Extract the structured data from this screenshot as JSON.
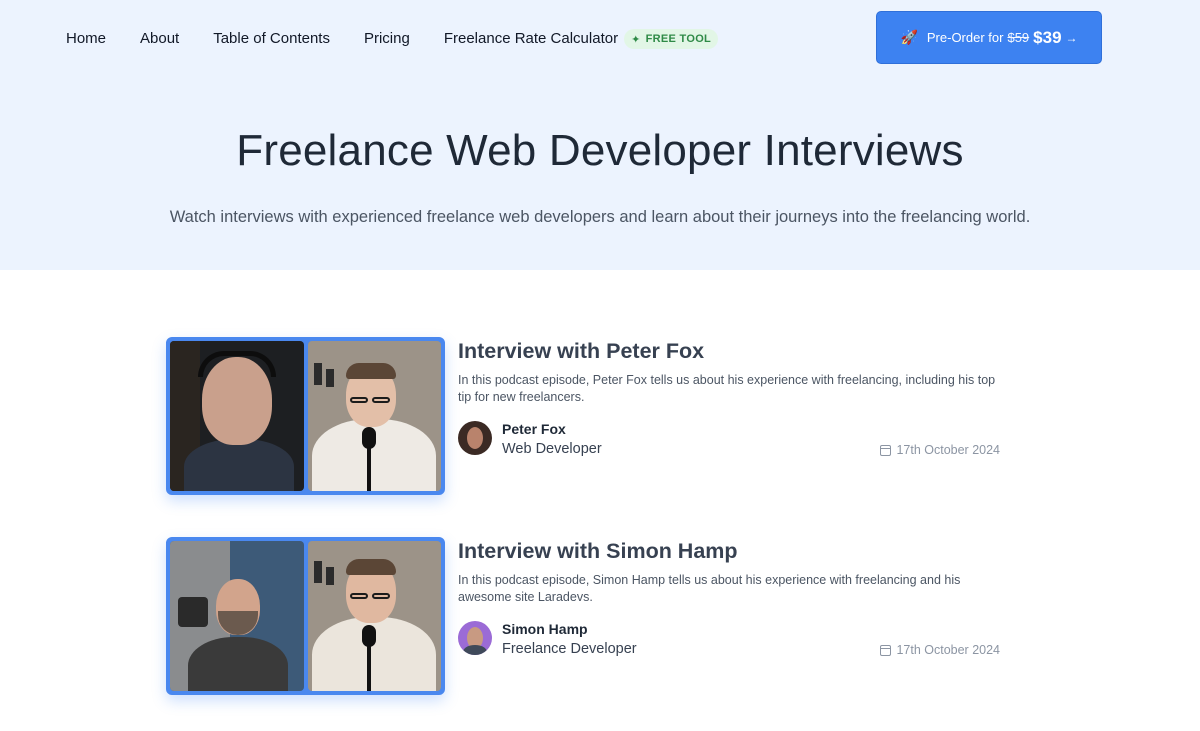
{
  "nav": {
    "items": [
      "Home",
      "About",
      "Table of Contents",
      "Pricing",
      "Freelance Rate Calculator"
    ],
    "badge": "FREE TOOL"
  },
  "cta": {
    "label": "Pre-Order for",
    "old_price": "$59",
    "new_price": "$39",
    "arrow": "→",
    "icon": "rocket-icon"
  },
  "hero": {
    "title": "Freelance Web Developer Interviews",
    "subtitle": "Watch interviews with experienced freelance web developers and learn about their journeys into the freelancing world."
  },
  "colors": {
    "hero_bg": "#ecf3fe",
    "accent": "#3d82f1",
    "badge_bg": "#e2f6e6",
    "badge_text": "#2f8a47"
  },
  "interviews": [
    {
      "title": "Interview with Peter Fox",
      "description": "In this podcast episode, Peter Fox tells us about his experience with freelancing, including his top tip for new freelancers.",
      "author": "Peter Fox",
      "role": "Web Developer",
      "date": "17th October 2024"
    },
    {
      "title": "Interview with Simon Hamp",
      "description": "In this podcast episode, Simon Hamp tells us about his experience with freelancing and his awesome site Laradevs.",
      "author": "Simon Hamp",
      "role": "Freelance Developer",
      "date": "17th October 2024"
    }
  ]
}
